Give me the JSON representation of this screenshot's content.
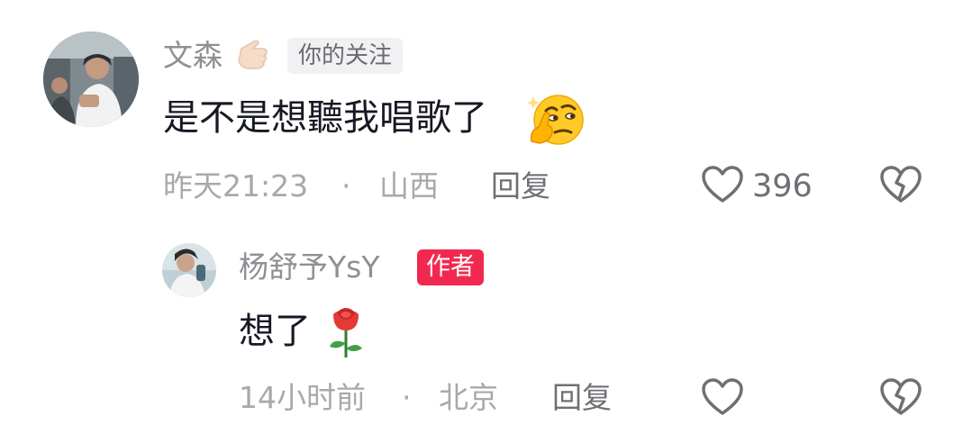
{
  "comment": {
    "username": "文森",
    "follow_tag": "你的关注",
    "text": "是不是想聽我唱歌了",
    "time": "昨天21:23",
    "separator": "·",
    "location": "山西",
    "reply_label": "回复",
    "like_count": "396",
    "username_emoji": "pointing-hand-icon",
    "text_emoji": "thinking-face-icon"
  },
  "reply": {
    "username": "杨舒予YsY",
    "author_tag": "作者",
    "text": "想了",
    "time": "14小时前",
    "separator": "·",
    "location": "北京",
    "reply_label": "回复",
    "text_emoji": "rose-icon"
  },
  "colors": {
    "author_tag_bg": "#f2294f",
    "username": "#8f8f94",
    "content": "#161823",
    "meta": "#a8a8ad"
  }
}
